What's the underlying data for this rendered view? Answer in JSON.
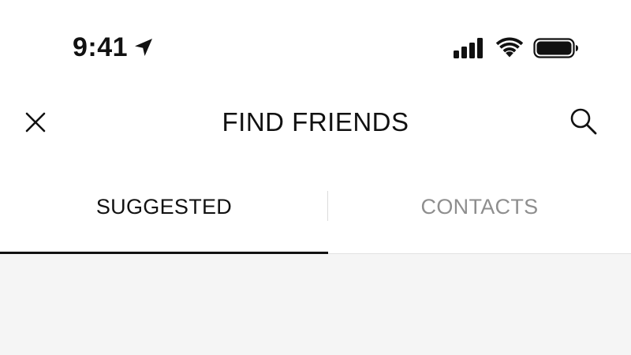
{
  "status_bar": {
    "time": "9:41",
    "location_icon": "location-arrow-icon",
    "signal_icon": "cellular-signal-icon",
    "wifi_icon": "wifi-icon",
    "battery_icon": "battery-full-icon"
  },
  "header": {
    "title": "FIND FRIENDS",
    "close_icon": "close-icon",
    "search_icon": "search-icon"
  },
  "tabs": [
    {
      "label": "SUGGESTED",
      "active": true
    },
    {
      "label": "CONTACTS",
      "active": false
    }
  ],
  "colors": {
    "text_primary": "#111111",
    "text_inactive": "#8e8e8e",
    "divider": "#dcdcdc",
    "content_background": "#f5f5f5",
    "active_underline": "#111111"
  }
}
